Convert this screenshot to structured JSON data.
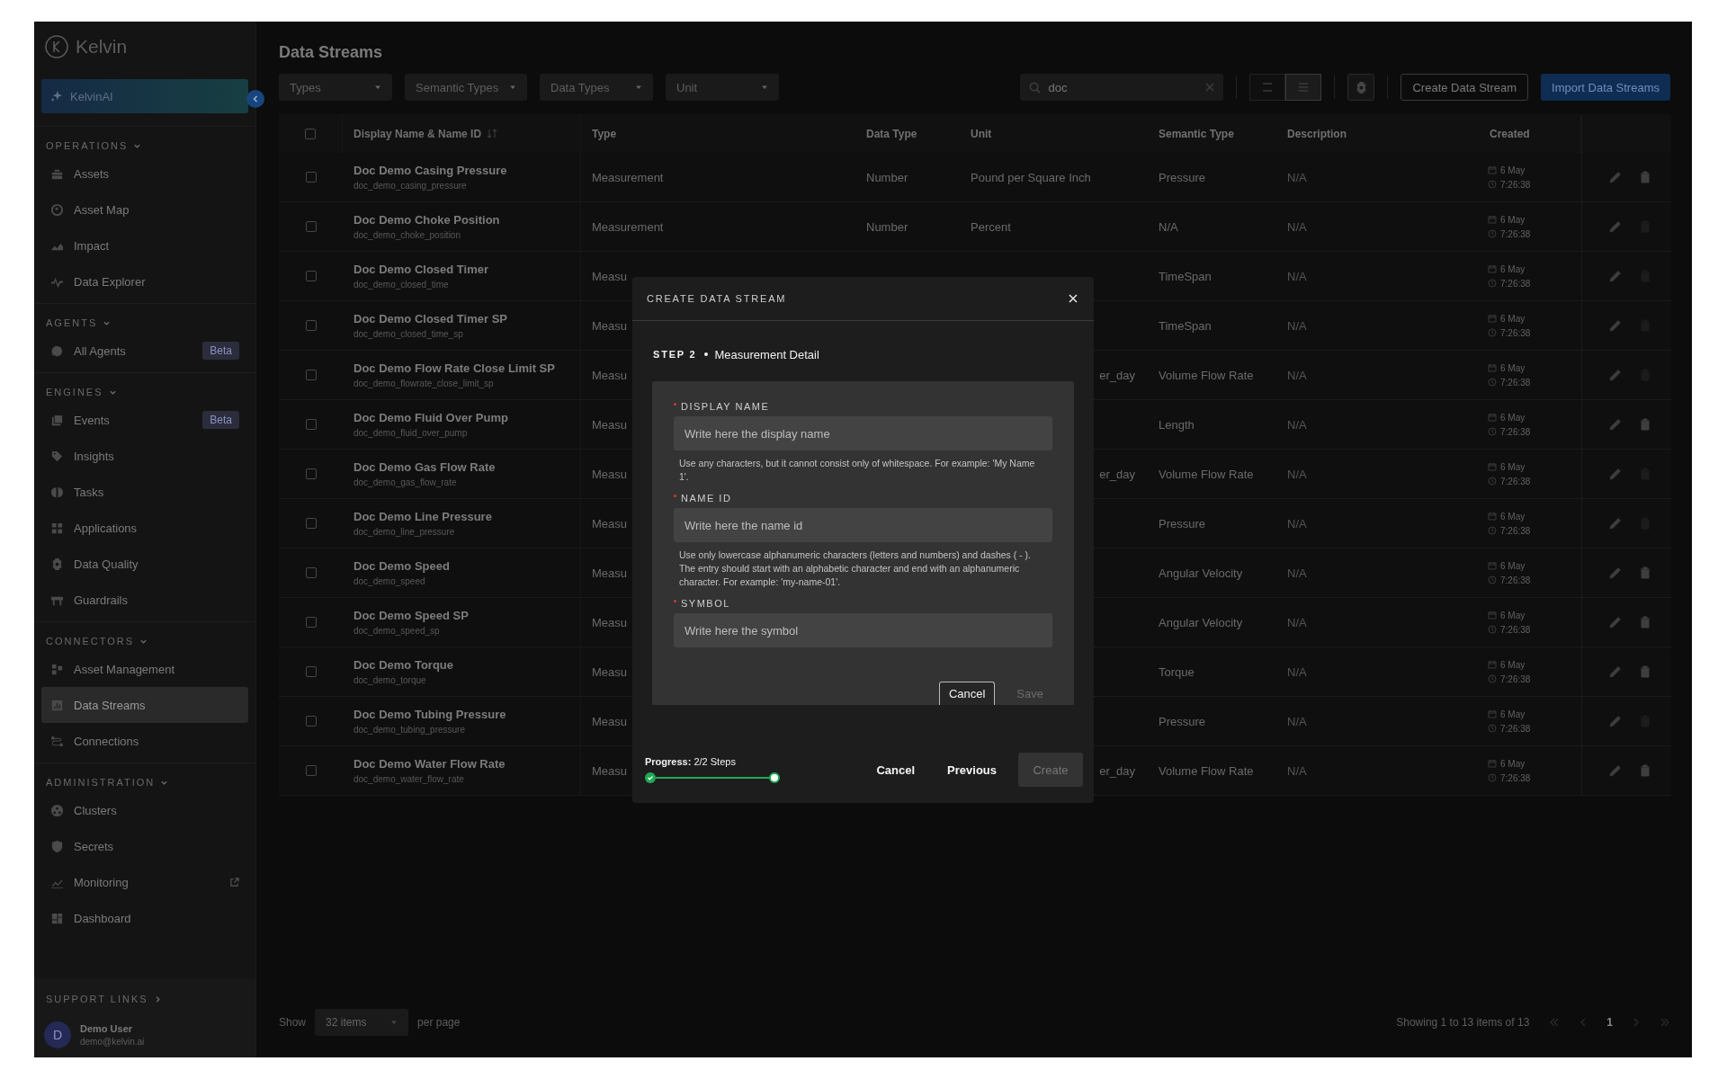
{
  "sidebar": {
    "logo": "Kelvin",
    "assistant": "KelvinAI",
    "sections": [
      {
        "title": "OPERATIONS",
        "expanded": true,
        "items": [
          {
            "label": "Assets",
            "selected": false
          },
          {
            "label": "Asset Map",
            "selected": false
          },
          {
            "label": "Impact",
            "selected": false
          },
          {
            "label": "Data Explorer",
            "selected": false
          }
        ]
      },
      {
        "title": "AGENTS",
        "expanded": true,
        "items": [
          {
            "label": "All Agents",
            "selected": false,
            "badge": "Beta"
          }
        ]
      },
      {
        "title": "ENGINES",
        "expanded": true,
        "items": [
          {
            "label": "Events",
            "selected": false,
            "badge": "Beta"
          },
          {
            "label": "Insights",
            "selected": false
          },
          {
            "label": "Tasks",
            "selected": false
          },
          {
            "label": "Applications",
            "selected": false
          },
          {
            "label": "Data Quality",
            "selected": false
          },
          {
            "label": "Guardrails",
            "selected": false
          }
        ]
      },
      {
        "title": "CONNECTORS",
        "expanded": true,
        "items": [
          {
            "label": "Asset Management",
            "selected": false
          },
          {
            "label": "Data Streams",
            "selected": true
          },
          {
            "label": "Connections",
            "selected": false
          }
        ]
      },
      {
        "title": "ADMINISTRATION",
        "expanded": true,
        "items": [
          {
            "label": "Clusters",
            "selected": false
          },
          {
            "label": "Secrets",
            "selected": false
          },
          {
            "label": "Monitoring",
            "selected": false,
            "external": true
          },
          {
            "label": "Dashboard",
            "selected": false
          }
        ]
      }
    ],
    "support_links": "SUPPORT LINKS",
    "user": {
      "initial": "D",
      "name": "Demo User",
      "email": "demo@kelvin.ai"
    }
  },
  "page_title": "Data Streams",
  "filters": [
    {
      "placeholder": "Types"
    },
    {
      "placeholder": "Semantic Types"
    },
    {
      "placeholder": "Data Types"
    },
    {
      "placeholder": "Unit"
    }
  ],
  "search": {
    "value": "doc"
  },
  "view_toggle": [
    {
      "selected": false
    },
    {
      "selected": true
    }
  ],
  "buttons": {
    "create": "Create Data Stream",
    "import": "Import Data Streams"
  },
  "table": {
    "select_all_checked": false,
    "columns": [
      "Display Name & Name ID",
      "Type",
      "Data Type",
      "Unit",
      "Semantic Type",
      "Description",
      "Created"
    ],
    "rows": [
      {
        "checked": false,
        "name": "Doc Demo Casing Pressure",
        "id": "doc_demo_casing_pressure",
        "type": "Measurement",
        "data_type": "Number",
        "unit": "Pound per Square Inch",
        "semantic": "Pressure",
        "description": "N/A",
        "date": "6 May",
        "time": "7:26:38",
        "deletable": true
      },
      {
        "checked": false,
        "name": "Doc Demo Choke Position",
        "id": "doc_demo_choke_position",
        "type": "Measurement",
        "data_type": "Number",
        "unit": "Percent",
        "semantic": "N/A",
        "description": "N/A",
        "date": "6 May",
        "time": "7:26:38",
        "deletable": false
      },
      {
        "checked": false,
        "name": "Doc Demo Closed Timer",
        "id": "doc_demo_closed_time",
        "type": "Measu",
        "semantic": "TimeSpan",
        "description": "N/A",
        "date": "6 May",
        "time": "7:26:38",
        "deletable": false
      },
      {
        "checked": false,
        "name": "Doc Demo Closed Timer SP",
        "id": "doc_demo_closed_time_sp",
        "type": "Measu",
        "semantic": "TimeSpan",
        "description": "N/A",
        "date": "6 May",
        "time": "7:26:38",
        "deletable": false
      },
      {
        "checked": false,
        "name": "Doc Demo Flow Rate Close Limit SP",
        "id": "doc_demo_flowrate_close_limit_sp",
        "type": "Measu",
        "unit": "er_day",
        "semantic": "Volume Flow Rate",
        "description": "N/A",
        "date": "6 May",
        "time": "7:26:38",
        "deletable": false
      },
      {
        "checked": false,
        "name": "Doc Demo Fluid Over Pump",
        "id": "doc_demo_fluid_over_pump",
        "type": "Measu",
        "semantic": "Length",
        "description": "N/A",
        "date": "6 May",
        "time": "7:26:38",
        "deletable": true
      },
      {
        "checked": false,
        "name": "Doc Demo Gas Flow Rate",
        "id": "doc_demo_gas_flow_rate",
        "type": "Measu",
        "unit": "er_day",
        "semantic": "Volume Flow Rate",
        "description": "N/A",
        "date": "6 May",
        "time": "7:26:38",
        "deletable": false
      },
      {
        "checked": false,
        "name": "Doc Demo Line Pressure",
        "id": "doc_demo_line_pressure",
        "type": "Measu",
        "semantic": "Pressure",
        "description": "N/A",
        "date": "6 May",
        "time": "7:26:38",
        "deletable": false
      },
      {
        "checked": false,
        "name": "Doc Demo Speed",
        "id": "doc_demo_speed",
        "type": "Measu",
        "semantic": "Angular Velocity",
        "description": "N/A",
        "date": "6 May",
        "time": "7:26:38",
        "deletable": true
      },
      {
        "checked": false,
        "name": "Doc Demo Speed SP",
        "id": "doc_demo_speed_sp",
        "type": "Measu",
        "semantic": "Angular Velocity",
        "description": "N/A",
        "date": "6 May",
        "time": "7:26:38",
        "deletable": true
      },
      {
        "checked": false,
        "name": "Doc Demo Torque",
        "id": "doc_demo_torque",
        "type": "Measu",
        "semantic": "Torque",
        "description": "N/A",
        "date": "6 May",
        "time": "7:26:38",
        "deletable": true
      },
      {
        "checked": false,
        "name": "Doc Demo Tubing Pressure",
        "id": "doc_demo_tubing_pressure",
        "type": "Measu",
        "semantic": "Pressure",
        "description": "N/A",
        "date": "6 May",
        "time": "7:26:38",
        "deletable": false
      },
      {
        "checked": false,
        "name": "Doc Demo Water Flow Rate",
        "id": "doc_demo_water_flow_rate",
        "type": "Measu",
        "unit": "er_day",
        "semantic": "Volume Flow Rate",
        "description": "N/A",
        "date": "6 May",
        "time": "7:26:38",
        "deletable": true
      }
    ]
  },
  "pagination": {
    "show": "Show",
    "page_size": "32 items",
    "per_page": "per page",
    "summary": "Showing 1 to 13 items of 13",
    "pages": [
      {
        "label": "1",
        "selected": true
      }
    ]
  },
  "modal": {
    "title": "CREATE DATA STREAM",
    "step": "STEP 2",
    "step_name": "Measurement Detail",
    "fields": [
      {
        "label": "DISPLAY NAME",
        "required": true,
        "placeholder": "Write here the display name",
        "hint": "Use any characters, but it cannot consist only of whitespace. For example: 'My Name 1'."
      },
      {
        "label": "NAME ID",
        "required": true,
        "placeholder": "Write here the name id",
        "hint": "Use only lowercase alphanumeric characters (letters and numbers) and dashes ( - ). The entry should start with an alphabetic character and end with an alphanumeric character. For example: 'my-name-01'."
      },
      {
        "label": "SYMBOL",
        "required": true,
        "placeholder": "Write here the symbol"
      }
    ],
    "form_buttons": {
      "cancel": "Cancel",
      "save": "Save",
      "save_disabled": true
    },
    "progress": {
      "text": "**Progress:** 2/2 Steps",
      "level": 1
    },
    "footer_buttons": {
      "cancel": "Cancel",
      "previous": "Previous",
      "create": "Create",
      "create_disabled": true
    }
  }
}
